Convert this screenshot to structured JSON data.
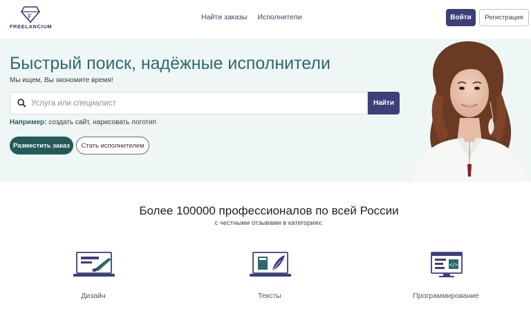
{
  "header": {
    "logo_text": "FREELANCIUM",
    "nav": [
      "Найти заказы",
      "Исполнители"
    ],
    "login_label": "Войти",
    "register_label": "Регистрация"
  },
  "hero": {
    "title": "Быстрый поиск, надёжные исполнители",
    "subtitle": "Мы ищем, Вы экономите время!",
    "search_placeholder": "Услуга или специалист",
    "search_value": "",
    "find_label": "Найти",
    "example_label": "Например:",
    "example_text": " создать сайт, нарисовать логотип",
    "post_order_label": "Разместить заказ",
    "become_freelancer_label": "Стать исполнителем"
  },
  "stats": {
    "title": "Более 100000 профессионалов по всей России",
    "subtitle": "с честными отзывами в категориях:"
  },
  "categories": [
    {
      "label": "Дизайн",
      "icon": "laptop-brush-icon"
    },
    {
      "label": "Тексты",
      "icon": "laptop-book-quill-icon"
    },
    {
      "label": "Программирование",
      "icon": "monitor-code-icon"
    }
  ],
  "colors": {
    "primary": "#3c3f7a",
    "teal": "#245a57",
    "hero_bg": "#eef7f6",
    "title": "#2d6a6a"
  }
}
